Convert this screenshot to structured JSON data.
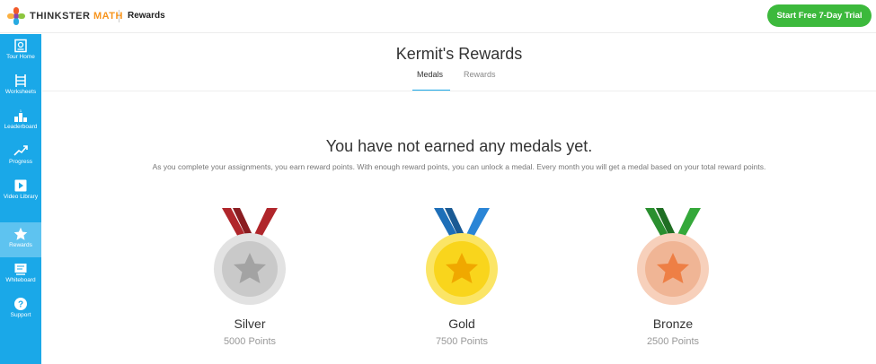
{
  "header": {
    "brand_part1": "THINKSTER",
    "brand_part2": "MATH",
    "page_label": "Rewards",
    "trial_button": "Start Free 7-Day Trial"
  },
  "sidebar": {
    "items": [
      {
        "label": "Tour Home",
        "icon": "home-icon"
      },
      {
        "label": "Worksheets",
        "icon": "worksheets-icon"
      },
      {
        "label": "Leaderboard",
        "icon": "leaderboard-icon"
      },
      {
        "label": "Progress",
        "icon": "progress-icon"
      },
      {
        "label": "Video Library",
        "icon": "video-icon"
      },
      {
        "label": "Rewards",
        "icon": "star-icon",
        "active": true
      },
      {
        "label": "Whiteboard",
        "icon": "whiteboard-icon"
      },
      {
        "label": "Support",
        "icon": "help-icon"
      }
    ],
    "bg_color": "#1aa8e8"
  },
  "main": {
    "title": "Kermit's Rewards",
    "tabs": [
      {
        "label": "Medals",
        "active": true
      },
      {
        "label": "Rewards",
        "active": false
      }
    ],
    "headline": "You have not earned any medals yet.",
    "description": "As you complete your assignments, you earn reward points. With enough reward points, you can unlock a medal. Every month you will get a medal based on your total reward points."
  },
  "medals": [
    {
      "name": "Silver",
      "points": "5000 Points",
      "ribbon_color": "#b0262b",
      "disc_color": "#c9c9c9",
      "star_color": "#a3a3a3"
    },
    {
      "name": "Gold",
      "points": "7500 Points",
      "ribbon_color": "#1e6fb8",
      "disc_color": "#f9d51c",
      "star_color": "#f0a800"
    },
    {
      "name": "Bronze",
      "points": "2500 Points",
      "ribbon_color": "#2a8f2f",
      "disc_color": "#f0b595",
      "star_color": "#ee7f45"
    }
  ]
}
